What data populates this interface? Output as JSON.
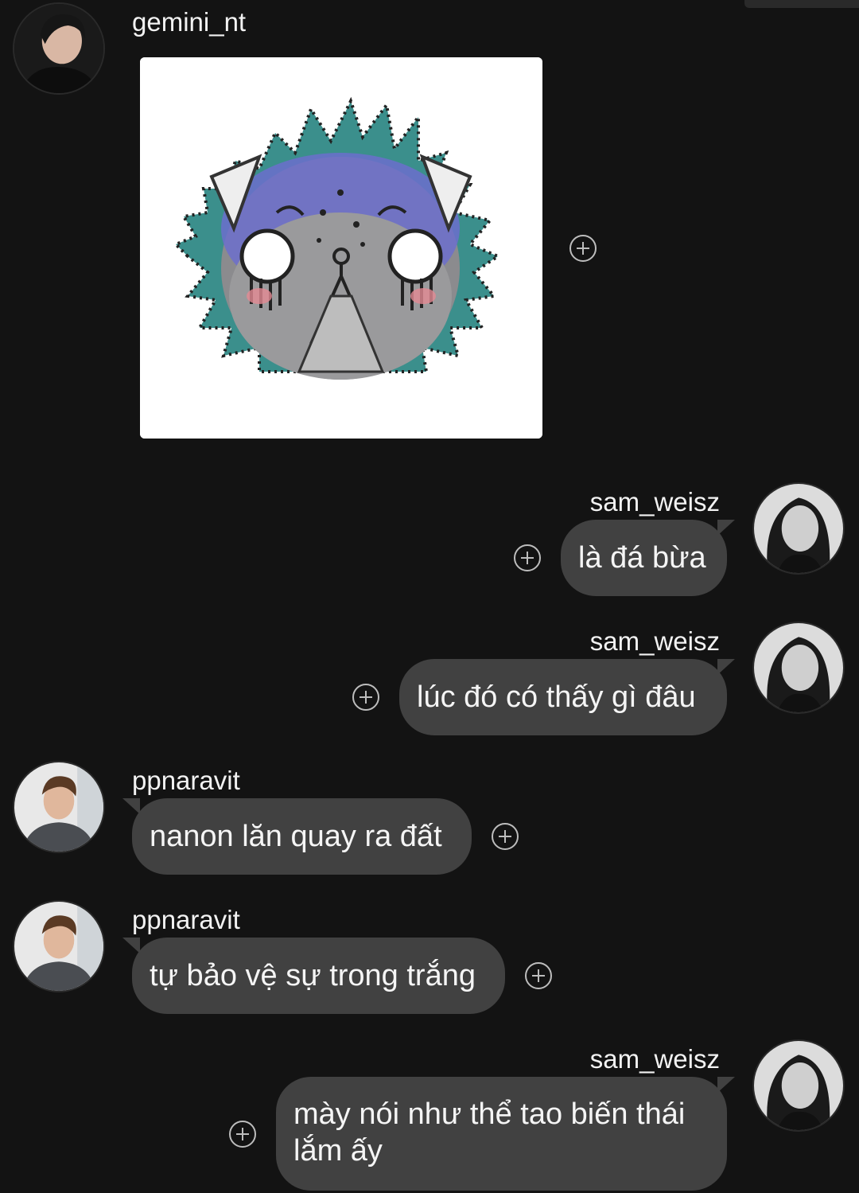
{
  "messages": [
    {
      "sender": "gemini_nt",
      "type": "sticker",
      "sticker_icon": "crying-cat-lion-sticker"
    },
    {
      "sender": "sam_weisz",
      "type": "text",
      "text": "là đá bừa"
    },
    {
      "sender": "sam_weisz",
      "type": "text",
      "text": "lúc đó có thấy gì đâu"
    },
    {
      "sender": "ppnaravit",
      "type": "text",
      "text": "nanon lăn quay ra đất"
    },
    {
      "sender": "ppnaravit",
      "type": "text",
      "text": "tự bảo vệ sự trong trắng"
    },
    {
      "sender": "sam_weisz",
      "type": "text",
      "text": "mày nói như thể tao biến thái lắm ấy"
    }
  ],
  "colors": {
    "background": "#131313",
    "bubble": "#414141",
    "text": "#f5f5f5",
    "icon": "#bdbdbd"
  },
  "icons": {
    "react": "add-reaction-icon"
  }
}
